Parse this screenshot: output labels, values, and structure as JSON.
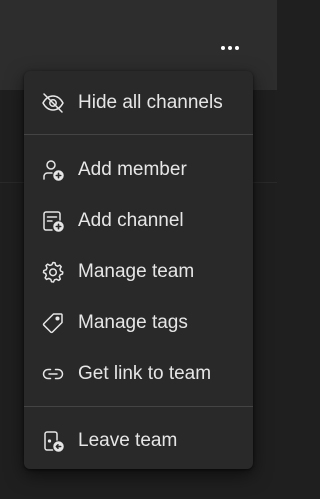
{
  "colors": {
    "background": "#1f1f1f",
    "header": "#2d2d2d",
    "menu_background": "#292929",
    "menu_text": "#e6e6e6",
    "separator": "#444444"
  },
  "header": {
    "more_icon": "more-horizontal-icon"
  },
  "menu": {
    "items": [
      {
        "label": "Hide all channels",
        "icon": "eye-off-icon"
      },
      {
        "label": "Add member",
        "icon": "person-add-icon"
      },
      {
        "label": "Add channel",
        "icon": "channel-add-icon"
      },
      {
        "label": "Manage team",
        "icon": "gear-icon"
      },
      {
        "label": "Manage tags",
        "icon": "tag-icon"
      },
      {
        "label": "Get link to team",
        "icon": "link-icon"
      },
      {
        "label": "Leave team",
        "icon": "leave-icon"
      }
    ]
  }
}
